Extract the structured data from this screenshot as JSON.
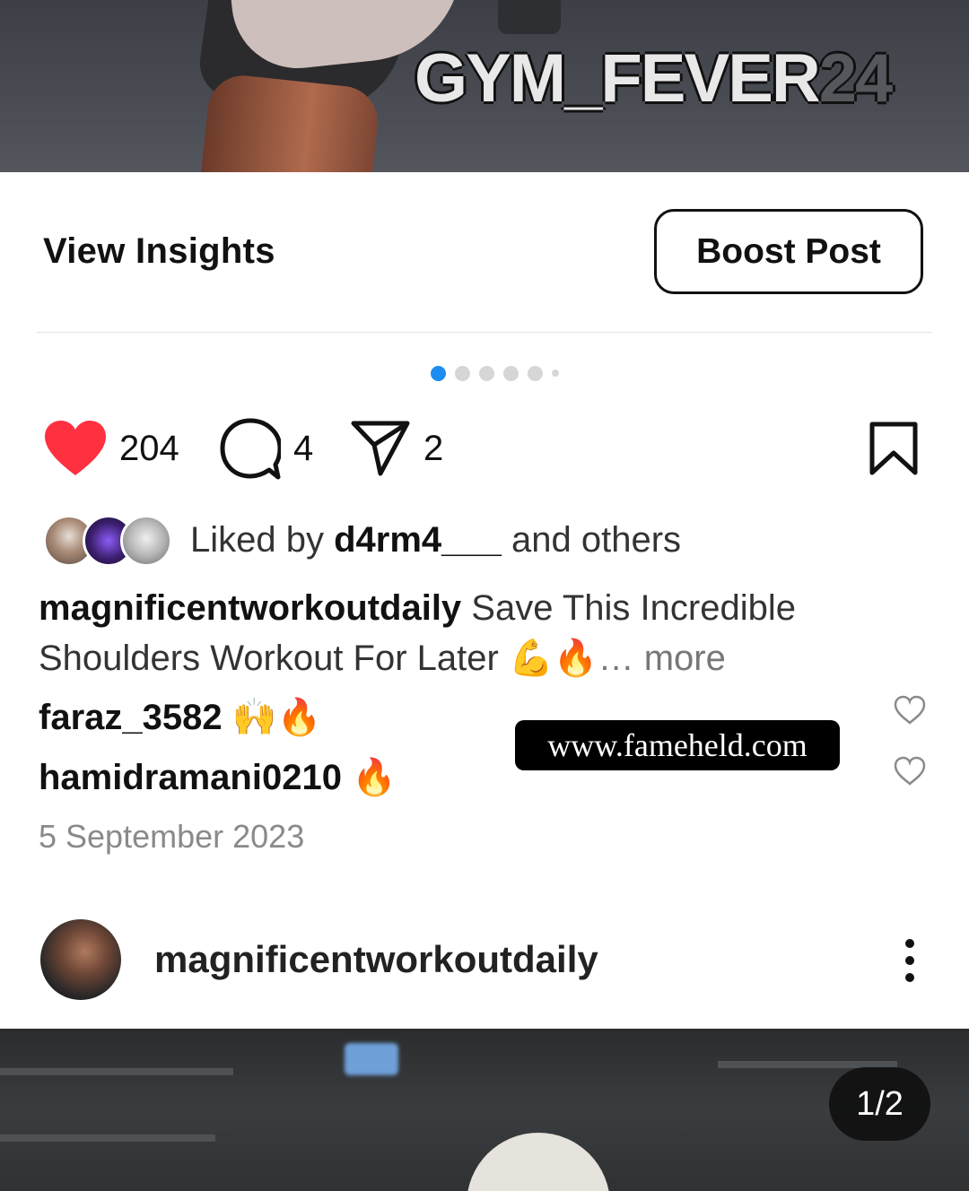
{
  "top_media": {
    "watermark_text": "GYM_FEVER",
    "watermark_number": "24"
  },
  "insights": {
    "view_insights_label": "View Insights",
    "boost_post_label": "Boost Post"
  },
  "pager": {
    "total_dots": 6,
    "active_index": 0
  },
  "actions": {
    "likes_count": "204",
    "comments_count": "4",
    "shares_count": "2",
    "like_icon": "heart-filled-icon",
    "comment_icon": "comment-bubble-icon",
    "share_icon": "paper-plane-icon",
    "save_icon": "bookmark-icon",
    "like_color": "#ff3040"
  },
  "liked_by": {
    "prefix": "Liked by ",
    "user": "d4rm4___",
    "suffix": " and others"
  },
  "caption": {
    "username": "magnificentworkoutdaily",
    "text": " Save This Incredible Shoulders Workout For Later ",
    "emojis": "💪🔥",
    "ellipsis": "… ",
    "more_label": "more"
  },
  "comments": [
    {
      "username": "faraz_3582",
      "emojis": "🙌🔥"
    },
    {
      "username": "hamidramani0210",
      "emojis": "🔥"
    }
  ],
  "overlay": {
    "website": "www.fameheld.com"
  },
  "post_date": "5 September 2023",
  "next_post": {
    "username": "magnificentworkoutdaily",
    "page_indicator": "1/2"
  },
  "colors": {
    "accent_blue": "#1d8cf0",
    "text_primary": "#111111",
    "text_secondary": "#8a8a8a"
  }
}
